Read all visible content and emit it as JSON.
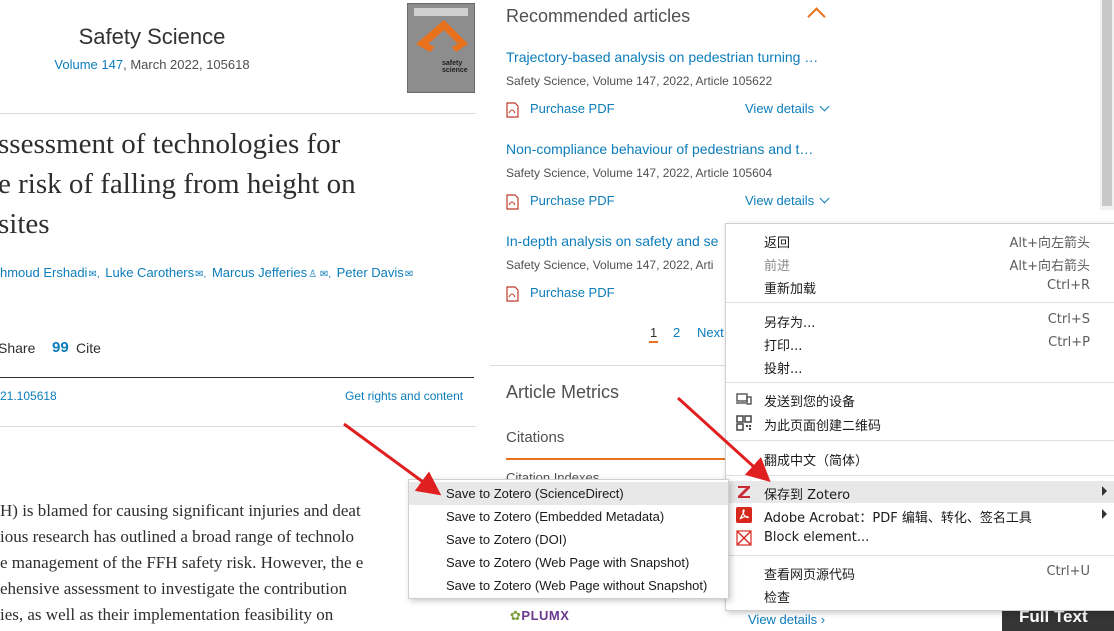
{
  "journal": {
    "name": "Safety Science",
    "volume_link": "Volume 147",
    "meta_rest": ", March 2022, 105618",
    "cover_text": "safety science"
  },
  "article": {
    "title_lines": [
      "ssessment of technologies for",
      "e risk of falling from height on",
      "sites"
    ],
    "authors": [
      {
        "name": "hmoud Ershadi",
        "after": "✉, "
      },
      {
        "name": "Luke Carothers",
        "after": "✉, "
      },
      {
        "name": "Marcus Jefferies",
        "after": "♙ ✉, "
      },
      {
        "name": "Peter Davis",
        "after": "✉"
      }
    ],
    "share_label": "Share",
    "cite_icon": "99",
    "cite_label": "Cite",
    "doi": "21.105618",
    "rights_link": "Get rights and content",
    "paragraph_lines": [
      "H) is blamed for causing significant injuries and deat",
      "ious research has outlined a broad range of technolo",
      "e management of the FFH safety risk. However, the e",
      "ehensive assessment to investigate the contribution",
      "ies, as well as their implementation feasibility on"
    ]
  },
  "recommended": {
    "header": "Recommended articles",
    "items": [
      {
        "title": "Trajectory-based analysis on pedestrian turning …",
        "meta": "Safety Science, Volume 147, 2022, Article 105622",
        "pdf_label": "Purchase PDF",
        "view_label": "View details"
      },
      {
        "title": "Non-compliance behaviour of pedestrians and t…",
        "meta": "Safety Science, Volume 147, 2022, Article 105604",
        "pdf_label": "Purchase PDF",
        "view_label": "View details"
      },
      {
        "title": "In-depth analysis on safety and se",
        "meta": "Safety Science, Volume 147, 2022, Arti",
        "pdf_label": "Purchase PDF",
        "view_label": ""
      }
    ],
    "pagination": {
      "current": "1",
      "next_page": "2",
      "next_label": "Next"
    }
  },
  "metrics": {
    "header": "Article Metrics",
    "citations_label": "Citations",
    "citations_sub": "Citation Indexes",
    "plumx_label": "PLUMX",
    "view_details": "View details  ›",
    "full_text": "Full Text"
  },
  "context_menu": {
    "items": [
      {
        "label": "返回",
        "shortcut": "Alt+向左箭头"
      },
      {
        "label": "前进",
        "shortcut": "Alt+向右箭头"
      },
      {
        "label": "重新加载",
        "shortcut": "Ctrl+R"
      },
      {
        "label": "另存为...",
        "shortcut": "Ctrl+S"
      },
      {
        "label": "打印...",
        "shortcut": "Ctrl+P"
      },
      {
        "label": "投射...",
        "shortcut": ""
      },
      {
        "label": "发送到您的设备",
        "shortcut": ""
      },
      {
        "label": "为此页面创建二维码",
        "shortcut": ""
      },
      {
        "label": "翻成中文（简体）",
        "shortcut": ""
      },
      {
        "label": "保存到 Zotero",
        "shortcut": ""
      },
      {
        "label": "Adobe Acrobat：PDF 编辑、转化、签名工具",
        "shortcut": ""
      },
      {
        "label": "Block element...",
        "shortcut": ""
      },
      {
        "label": "查看网页源代码",
        "shortcut": "Ctrl+U"
      },
      {
        "label": "检查",
        "shortcut": ""
      }
    ]
  },
  "zotero_submenu": {
    "items": [
      "Save to Zotero (ScienceDirect)",
      "Save to Zotero (Embedded Metadata)",
      "Save to Zotero (DOI)",
      "Save to Zotero (Web Page with Snapshot)",
      "Save to Zotero (Web Page without Snapshot)"
    ]
  },
  "colors": {
    "link": "#0c7dbb",
    "accent_orange": "#e9711c",
    "annotation_arrow": "#e02020",
    "zotero_red": "#cc2936",
    "acrobat_red": "#d7281e"
  }
}
